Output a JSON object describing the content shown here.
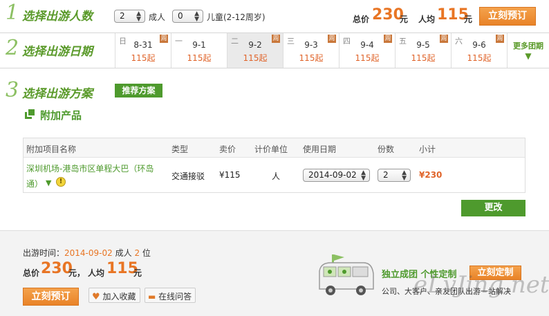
{
  "step1": {
    "num": "1",
    "title": "选择出游人数",
    "adults_value": "2",
    "adults_label": "成人",
    "children_value": "0",
    "children_label": "儿童(2-12周岁)",
    "total_label": "总价",
    "total_value": "230",
    "yuan": "元",
    "per_label": "人均",
    "per_value": "115",
    "book_button": "立刻预订"
  },
  "step2": {
    "num": "2",
    "title": "选择出游日期",
    "days": [
      {
        "weekday": "日",
        "date": "8-31",
        "price": "115起",
        "tag": "周"
      },
      {
        "weekday": "一",
        "date": "9-1",
        "price": "115起",
        "tag": ""
      },
      {
        "weekday": "二",
        "date": "9-2",
        "price": "115起",
        "tag": "周"
      },
      {
        "weekday": "三",
        "date": "9-3",
        "price": "115起",
        "tag": "周"
      },
      {
        "weekday": "四",
        "date": "9-4",
        "price": "115起",
        "tag": "周"
      },
      {
        "weekday": "五",
        "date": "9-5",
        "price": "115起",
        "tag": "周"
      },
      {
        "weekday": "六",
        "date": "9-6",
        "price": "115起",
        "tag": "周"
      }
    ],
    "selected_index": 2,
    "more_label": "更多团期",
    "more_arrow": "▼"
  },
  "step3": {
    "num": "3",
    "title": "选择出游方案",
    "recommend_button": "推荐方案",
    "addon_title": "附加产品",
    "table_headers": [
      "附加项目名称",
      "类型",
      "卖价",
      "计价单位",
      "使用日期",
      "份数",
      "小计"
    ],
    "row": {
      "name_line1": "深圳机场-港岛市区单程大巴（环岛",
      "name_line2": "通）",
      "type": "交通接驳",
      "price": "¥115",
      "unit": "人",
      "date": "2014-09-02",
      "qty": "2",
      "subtotal": "¥230"
    },
    "change_button": "更改"
  },
  "summary": {
    "time_label": "出游时间：",
    "time_value": "2014-09-02",
    "adult_label": "成人",
    "adult_count": "2",
    "unit": "位",
    "total_label": "总价",
    "total_value": "230",
    "yuan": "元，",
    "per_label": "人均",
    "per_value": "115",
    "yuan2": "元",
    "book_button": "立刻预订",
    "fav_label": "加入收藏",
    "qa_label": "在线问答"
  },
  "promo": {
    "title": "独立成团 个性定制",
    "button": "立刻定制",
    "desc": "公司、大客户、亲友团队出游一站解决"
  },
  "watermark": "eLvJing.net",
  "colors": {
    "accent_green": "#5a9a2a",
    "accent_orange": "#e87524",
    "button_green": "#4e9a2d"
  }
}
